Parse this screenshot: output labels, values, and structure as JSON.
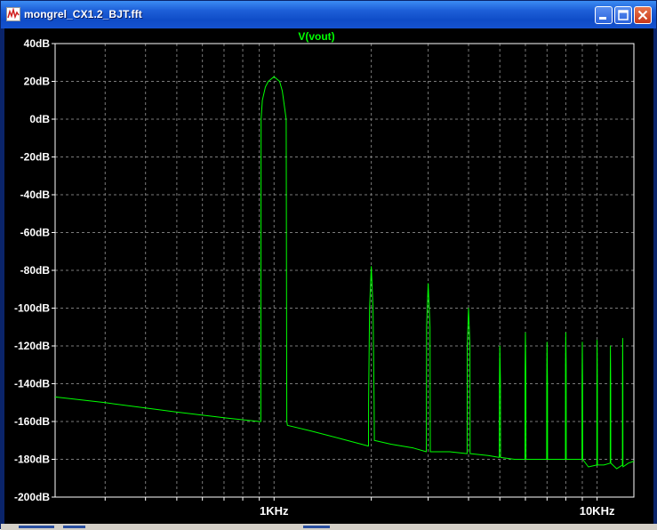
{
  "window": {
    "title": "mongrel_CX1.2_BJT.fft",
    "app_icon": "waveform-icon",
    "controls": {
      "minimize": "minimize-icon",
      "maximize": "maximize-icon",
      "close": "close-icon"
    }
  },
  "colors": {
    "background": "#000000",
    "trace": "#00ff00",
    "axes_text": "#ffffff",
    "grid": "#7a7a7a",
    "title_text": "#00ff00"
  },
  "chart_data": {
    "type": "line",
    "title": "V(vout)",
    "xscale": "log",
    "xlabel": "",
    "ylabel": "",
    "xlim": [
      210,
      13000
    ],
    "ylim": [
      -200,
      40
    ],
    "yunit": "dB",
    "x_tick_labels": [
      "1KHz",
      "10KHz"
    ],
    "y_tick_labels": [
      "40dB",
      "20dB",
      "0dB",
      "-20dB",
      "-40dB",
      "-60dB",
      "-80dB",
      "-100dB",
      "-120dB",
      "-140dB",
      "-160dB",
      "-180dB",
      "-200dB"
    ],
    "grid": true,
    "series": [
      {
        "name": "V(vout)",
        "points": [
          [
            210,
            -147
          ],
          [
            300,
            -150
          ],
          [
            500,
            -155
          ],
          [
            700,
            -158
          ],
          [
            900,
            -160
          ],
          [
            910,
            -160
          ],
          [
            912,
            0
          ],
          [
            920,
            10
          ],
          [
            940,
            17
          ],
          [
            960,
            20
          ],
          [
            1000,
            22.5
          ],
          [
            1040,
            20
          ],
          [
            1060,
            15
          ],
          [
            1090,
            0
          ],
          [
            1095,
            -160
          ],
          [
            1100,
            -162
          ],
          [
            1300,
            -165
          ],
          [
            1600,
            -169
          ],
          [
            1960,
            -173
          ],
          [
            1962,
            -150
          ],
          [
            1975,
            -100
          ],
          [
            2000,
            -78
          ],
          [
            2025,
            -100
          ],
          [
            2040,
            -150
          ],
          [
            2045,
            -170
          ],
          [
            2300,
            -172
          ],
          [
            2700,
            -174
          ],
          [
            2960,
            -176
          ],
          [
            2965,
            -110
          ],
          [
            3000,
            -87
          ],
          [
            3040,
            -110
          ],
          [
            3045,
            -176
          ],
          [
            3500,
            -176
          ],
          [
            3960,
            -177
          ],
          [
            3965,
            -120
          ],
          [
            4000,
            -100
          ],
          [
            4040,
            -120
          ],
          [
            4045,
            -177
          ],
          [
            4600,
            -178
          ],
          [
            4980,
            -179
          ],
          [
            4985,
            -140
          ],
          [
            5000,
            -120
          ],
          [
            5020,
            -140
          ],
          [
            5025,
            -179
          ],
          [
            5550,
            -180
          ],
          [
            5980,
            -180
          ],
          [
            5985,
            -135
          ],
          [
            6000,
            -113
          ],
          [
            6020,
            -135
          ],
          [
            6025,
            -180
          ],
          [
            6500,
            -180
          ],
          [
            6980,
            -180
          ],
          [
            6985,
            -140
          ],
          [
            7000,
            -118
          ],
          [
            7020,
            -140
          ],
          [
            7025,
            -180
          ],
          [
            7500,
            -180
          ],
          [
            7980,
            -180
          ],
          [
            7985,
            -130
          ],
          [
            8000,
            -113
          ],
          [
            8020,
            -130
          ],
          [
            8025,
            -180
          ],
          [
            8500,
            -180
          ],
          [
            8980,
            -180
          ],
          [
            8985,
            -140
          ],
          [
            9000,
            -118
          ],
          [
            9020,
            -140
          ],
          [
            9025,
            -180
          ],
          [
            9400,
            -184
          ],
          [
            9980,
            -183
          ],
          [
            9985,
            -140
          ],
          [
            10000,
            -117
          ],
          [
            10020,
            -140
          ],
          [
            10025,
            -183
          ],
          [
            10500,
            -183
          ],
          [
            10980,
            -182
          ],
          [
            10985,
            -140
          ],
          [
            11000,
            -120
          ],
          [
            11020,
            -140
          ],
          [
            11025,
            -182
          ],
          [
            11500,
            -185
          ],
          [
            11980,
            -183
          ],
          [
            11985,
            -140
          ],
          [
            12000,
            -116
          ],
          [
            12020,
            -140
          ],
          [
            12025,
            -184
          ],
          [
            12500,
            -182
          ],
          [
            13000,
            -181
          ]
        ]
      }
    ]
  }
}
